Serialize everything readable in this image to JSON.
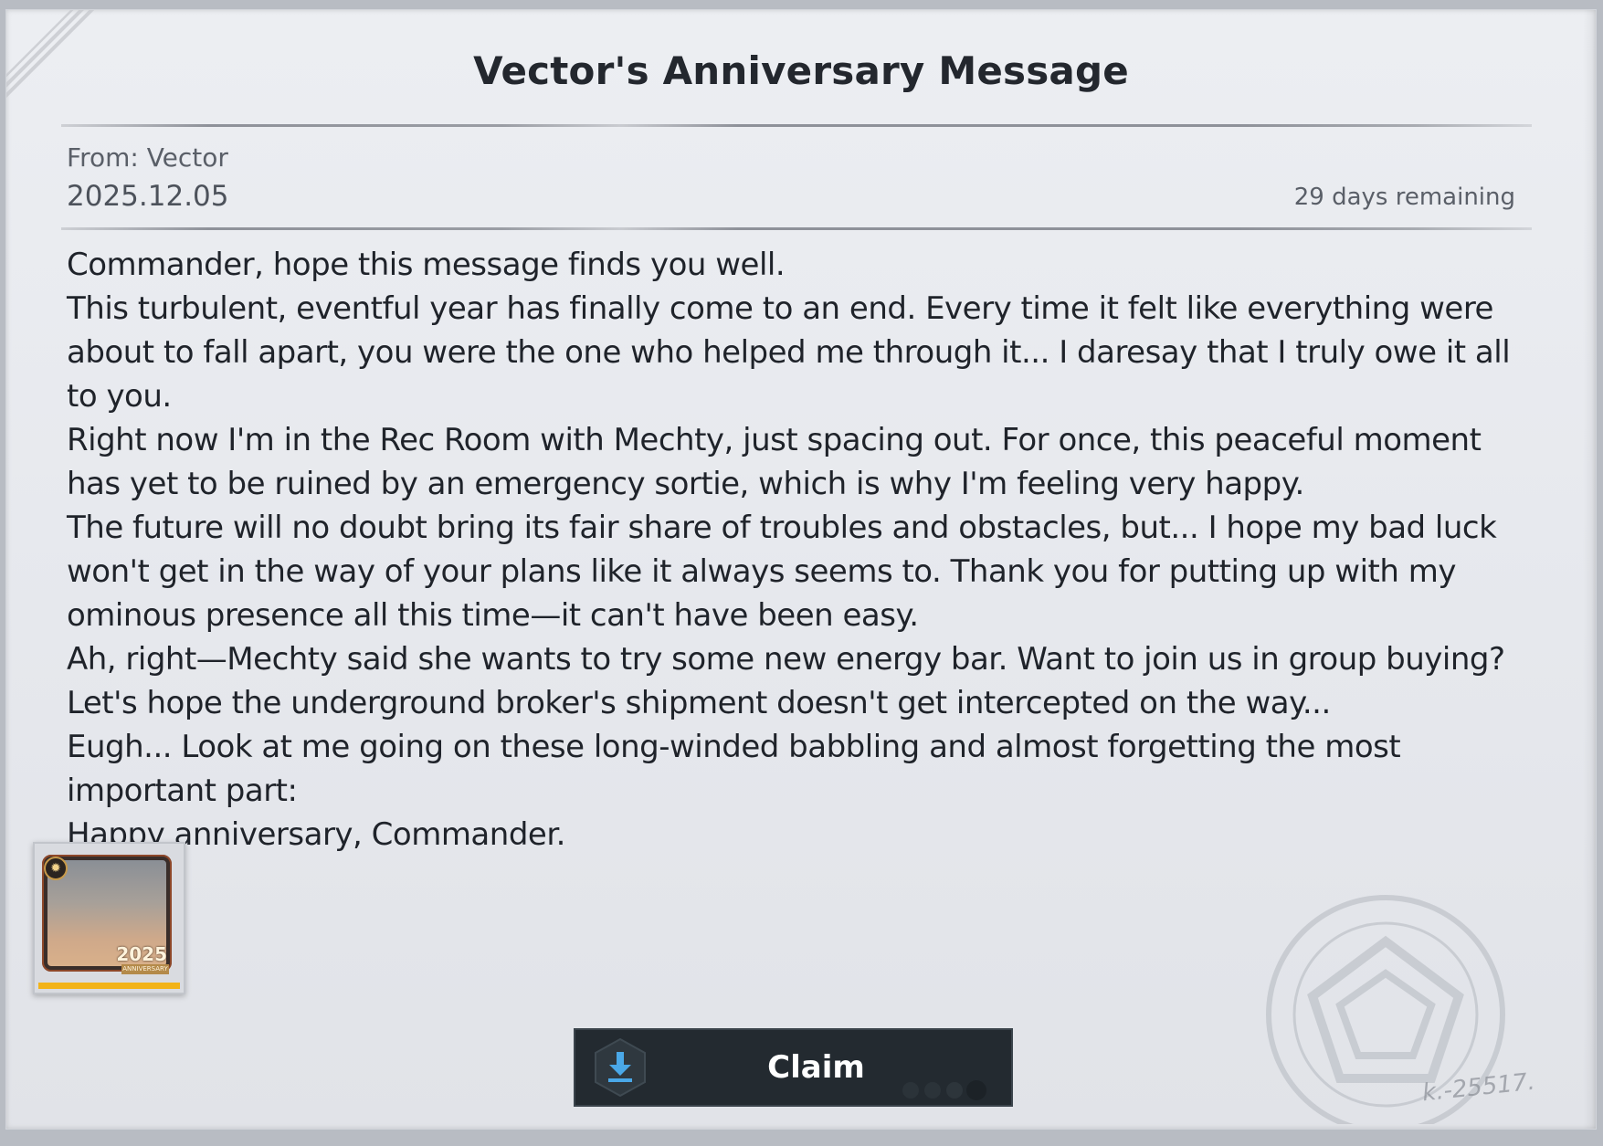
{
  "mail": {
    "title": "Vector's Anniversary Message",
    "from": "From: Vector",
    "date": "2025.12.05",
    "remaining": "29 days remaining",
    "body": [
      "Commander, hope this message finds you well.",
      "This turbulent, eventful year has finally come to an end. Every time it felt like everything were about to fall apart, you were the one who helped me through it... I daresay that I truly owe it all to you.",
      "Right now I'm in the Rec Room with Mechty, just spacing out. For once, this peaceful moment has yet to be ruined by an emergency sortie, which is why I'm feeling very happy.",
      "The future will no doubt bring its fair share of troubles and obstacles, but... I hope my bad luck won't get in the way of your plans like it always seems to. Thank you for putting up with my ominous presence all this time—it can't have been easy.",
      "Ah, right—Mechty said she wants to try some new energy bar. Want to join us in group buying? Let's hope the underground broker's shipment doesn't get intercepted on the way...",
      "Eugh... Look at me going on these long-winded babbling and almost forgetting the most important part:",
      "Happy anniversary, Commander."
    ]
  },
  "reward": {
    "icon": "anniversary-frame-icon",
    "year": "2025",
    "tag": "ANNIVERSARY",
    "rarity_color": "#f2b318"
  },
  "actions": {
    "claim_label": "Claim",
    "claim_icon": "download-icon"
  },
  "decor": {
    "signature": "k.-25517."
  },
  "colors": {
    "accent": "#232a30",
    "download_icon": "#4aa8e8",
    "paper": "#e8eaee"
  }
}
